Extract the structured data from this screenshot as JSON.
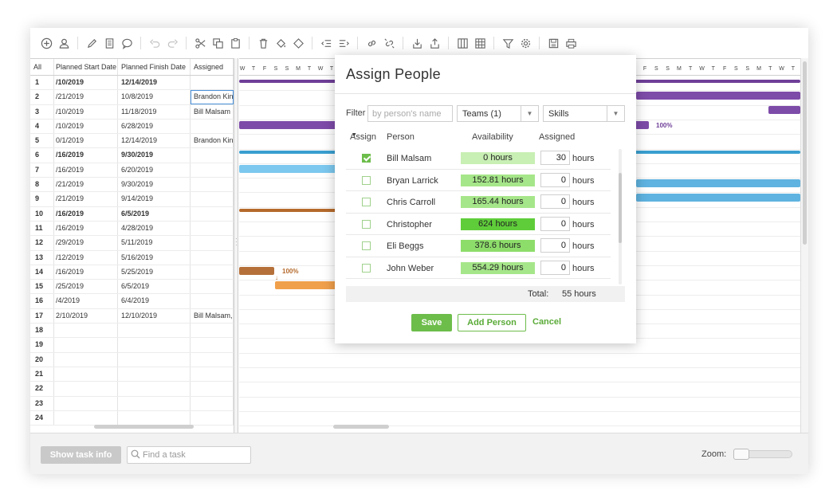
{
  "toolbar": {
    "icons": [
      "add-task-icon",
      "add-person-icon",
      "edit-icon",
      "notes-icon",
      "comment-icon",
      "undo-icon",
      "redo-icon",
      "cut-icon",
      "copy-icon",
      "paste-icon",
      "delete-icon",
      "fill-color-icon",
      "milestone-icon",
      "outdent-icon",
      "indent-icon",
      "link-icon",
      "unlink-icon",
      "import-icon",
      "export-icon",
      "columns-icon",
      "grid-icon",
      "filter-icon",
      "settings-icon",
      "save-icon",
      "print-icon"
    ]
  },
  "grid": {
    "headers": {
      "all": "All",
      "start": "Planned Start Date",
      "finish": "Planned Finish Date",
      "assigned": "Assigned"
    },
    "rows": [
      {
        "num": "1",
        "start": "/10/2019",
        "finish": "12/14/2019",
        "assigned": "",
        "bold": true
      },
      {
        "num": "2",
        "start": "/21/2019",
        "finish": "10/8/2019",
        "assigned": "Brandon Kinn",
        "bold": false
      },
      {
        "num": "3",
        "start": "/10/2019",
        "finish": "11/18/2019",
        "assigned": "Bill Malsam",
        "bold": false
      },
      {
        "num": "4",
        "start": "/10/2019",
        "finish": "6/28/2019",
        "assigned": "",
        "bold": false
      },
      {
        "num": "5",
        "start": "0/1/2019",
        "finish": "12/14/2019",
        "assigned": "Brandon Kin",
        "bold": false
      },
      {
        "num": "6",
        "start": "/16/2019",
        "finish": "9/30/2019",
        "assigned": "",
        "bold": true
      },
      {
        "num": "7",
        "start": "/16/2019",
        "finish": "6/20/2019",
        "assigned": "",
        "bold": false
      },
      {
        "num": "8",
        "start": "/21/2019",
        "finish": "9/30/2019",
        "assigned": "",
        "bold": false
      },
      {
        "num": "9",
        "start": "/21/2019",
        "finish": "9/14/2019",
        "assigned": "",
        "bold": false
      },
      {
        "num": "10",
        "start": "/16/2019",
        "finish": "6/5/2019",
        "assigned": "",
        "bold": true
      },
      {
        "num": "11",
        "start": "/16/2019",
        "finish": "4/28/2019",
        "assigned": "",
        "bold": false
      },
      {
        "num": "12",
        "start": "/29/2019",
        "finish": "5/11/2019",
        "assigned": "",
        "bold": false
      },
      {
        "num": "13",
        "start": "/12/2019",
        "finish": "5/16/2019",
        "assigned": "",
        "bold": false
      },
      {
        "num": "14",
        "start": "/16/2019",
        "finish": "5/25/2019",
        "assigned": "",
        "bold": false
      },
      {
        "num": "15",
        "start": "/25/2019",
        "finish": "6/5/2019",
        "assigned": "",
        "bold": false
      },
      {
        "num": "16",
        "start": "/4/2019",
        "finish": "6/4/2019",
        "assigned": "",
        "bold": false
      },
      {
        "num": "17",
        "start": "2/10/2019",
        "finish": "12/10/2019",
        "assigned": "Bill Malsam,",
        "bold": false
      },
      {
        "num": "18",
        "start": "",
        "finish": "",
        "assigned": "",
        "bold": false
      },
      {
        "num": "19",
        "start": "",
        "finish": "",
        "assigned": "",
        "bold": false
      },
      {
        "num": "20",
        "start": "",
        "finish": "",
        "assigned": "",
        "bold": false
      },
      {
        "num": "21",
        "start": "",
        "finish": "",
        "assigned": "",
        "bold": false
      },
      {
        "num": "22",
        "start": "",
        "finish": "",
        "assigned": "",
        "bold": false
      },
      {
        "num": "23",
        "start": "",
        "finish": "",
        "assigned": "",
        "bold": false
      },
      {
        "num": "24",
        "start": "",
        "finish": "",
        "assigned": "",
        "bold": false
      }
    ]
  },
  "gantt": {
    "days_left": [
      "W",
      "T",
      "F",
      "S",
      "S",
      "M",
      "T",
      "W",
      "T"
    ],
    "days_right": [
      "F",
      "S",
      "S",
      "M",
      "T",
      "W",
      "T",
      "F",
      "S",
      "S",
      "M",
      "T",
      "W",
      "T"
    ],
    "pct_row4": "100%",
    "pct_row14": "100%"
  },
  "footer": {
    "show_task_info": "Show task info",
    "find_placeholder": "Find a task",
    "zoom_label": "Zoom:"
  },
  "modal": {
    "title": "Assign People",
    "filter_label": "Filter",
    "filter_placeholder": "by person's name",
    "teams_value": "Teams (1)",
    "skills_value": "Skills",
    "col_assign": "Assign",
    "col_person": "Person",
    "col_availability": "Availability",
    "col_assigned": "Assigned",
    "hours_unit": "hours",
    "people": [
      {
        "name": "Bill Malsam",
        "availability": "0 hours",
        "assigned": "30",
        "checked": true,
        "avail_color": "#c8efb4"
      },
      {
        "name": "Bryan Larrick",
        "availability": "152.81 hours",
        "assigned": "0",
        "checked": false,
        "avail_color": "#a6e68a"
      },
      {
        "name": "Chris Carroll",
        "availability": "165.44 hours",
        "assigned": "0",
        "checked": false,
        "avail_color": "#a6e68a"
      },
      {
        "name": "Christopher",
        "availability": "624 hours",
        "assigned": "0",
        "checked": false,
        "avail_color": "#5fcd3a"
      },
      {
        "name": "Eli Beggs",
        "availability": "378.6 hours",
        "assigned": "0",
        "checked": false,
        "avail_color": "#8ddd6b"
      },
      {
        "name": "John Weber",
        "availability": "554.29 hours",
        "assigned": "0",
        "checked": false,
        "avail_color": "#a6e68a"
      }
    ],
    "total_label": "Total:",
    "total_value": "55 hours",
    "save": "Save",
    "add_person": "Add Person",
    "cancel": "Cancel"
  }
}
